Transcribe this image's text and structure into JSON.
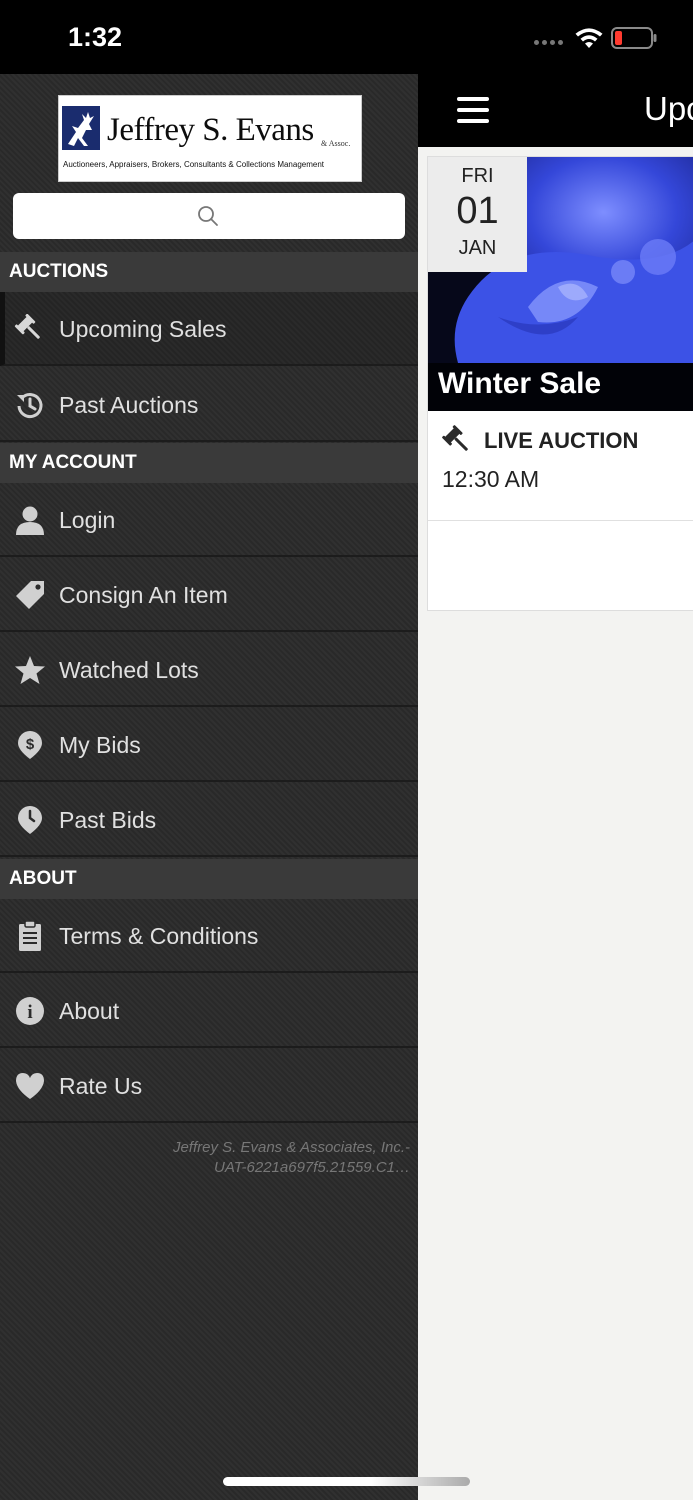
{
  "status_bar": {
    "time": "1:32"
  },
  "logo": {
    "name": "Jeffrey S. Evans",
    "suffix": "& Assoc.",
    "tagline": "Auctioneers, Appraisers, Brokers, Consultants & Collections Management"
  },
  "search": {
    "placeholder": ""
  },
  "sections": {
    "auctions": "AUCTIONS",
    "my_account": "MY ACCOUNT",
    "about": "ABOUT"
  },
  "menu": {
    "upcoming_sales": "Upcoming Sales",
    "past_auctions": "Past Auctions",
    "login": "Login",
    "consign": "Consign An Item",
    "watched_lots": "Watched Lots",
    "my_bids": "My Bids",
    "past_bids": "Past Bids",
    "terms": "Terms & Conditions",
    "about": "About",
    "rate_us": "Rate Us"
  },
  "version": {
    "line1": "Jeffrey S. Evans & Associates, Inc.-",
    "line2": "UAT-6221a697f5.21559.C1…"
  },
  "main": {
    "title": "Upcoming Sales",
    "card": {
      "day_of_week": "FRI",
      "day": "01",
      "month": "JAN",
      "title": "Winter Sale",
      "auction_type": "LIVE AUCTION",
      "time": "12:30 AM"
    }
  },
  "colors": {
    "drawer_bg": "#2b2b2b",
    "section_bg": "#3a3a3a",
    "topbar_bg": "#000000",
    "glass_blue": "#3a4fd6"
  },
  "icons": {
    "upcoming_sales": "gavel-icon",
    "past_auctions": "history-icon",
    "login": "user-icon",
    "consign": "tag-icon",
    "watched_lots": "star-icon",
    "my_bids": "dollar-pin-icon",
    "past_bids": "clock-pin-icon",
    "terms": "clipboard-icon",
    "about": "info-icon",
    "rate_us": "heart-icon"
  }
}
